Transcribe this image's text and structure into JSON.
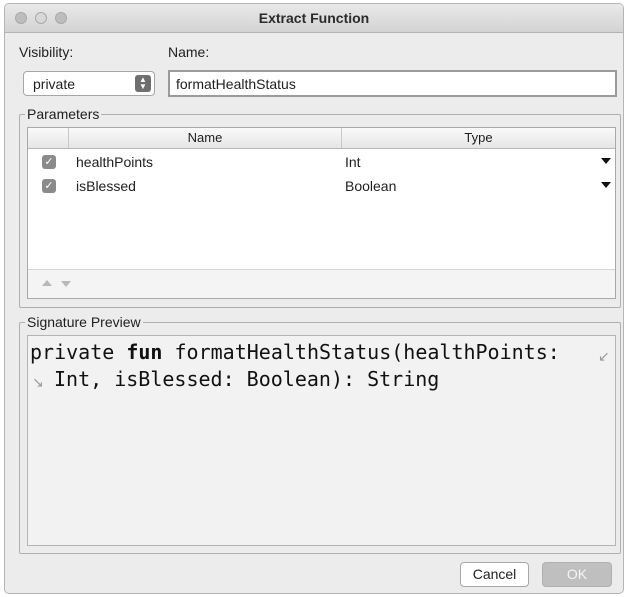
{
  "window": {
    "title": "Extract Function"
  },
  "form": {
    "visibility_label": "Visibility:",
    "visibility_value": "private",
    "name_label": "Name:",
    "name_value": "formatHealthStatus"
  },
  "parameters": {
    "group_label": "Parameters",
    "columns": [
      "Name",
      "Type"
    ],
    "rows": [
      {
        "checked": true,
        "name": "healthPoints",
        "type": "Int"
      },
      {
        "checked": true,
        "name": "isBlessed",
        "type": "Boolean"
      }
    ]
  },
  "signature": {
    "group_label": "Signature Preview",
    "line1_kw1": "private ",
    "line1_kw2": "fun",
    "line1_rest": " formatHealthStatus(healthPoints:",
    "line2": "Int, isBlessed: Boolean): String"
  },
  "buttons": {
    "cancel": "Cancel",
    "ok": "OK"
  },
  "icons": {
    "checkbox": "checkmark-icon",
    "move_up": "arrow-up-icon",
    "move_down": "arrow-down-icon",
    "wrap_start": "wrap-arrow-icon",
    "wrap_end": "wrap-arrow-icon"
  },
  "glyphs": {
    "check": "✓",
    "select_arrows": "▲\n▼",
    "wrap_end": "↙",
    "wrap_start": "↘"
  }
}
